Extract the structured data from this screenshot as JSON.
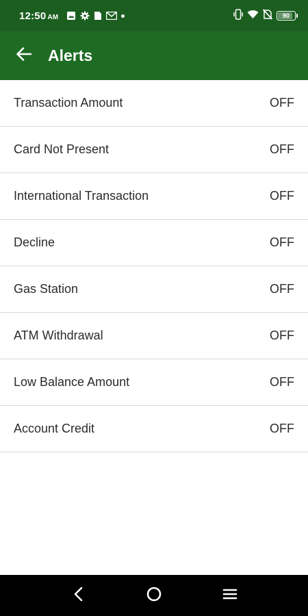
{
  "status_bar": {
    "time": "12:50",
    "ampm": "AM",
    "battery_level": "90",
    "icons": [
      "gallery-icon",
      "settings-icon",
      "sim-card-icon",
      "mail-icon",
      "dot-icon",
      "vibrate-icon",
      "wifi-icon",
      "no-sim-icon",
      "battery-icon"
    ]
  },
  "app_bar": {
    "title": "Alerts",
    "back_icon": "arrow-left-icon"
  },
  "alerts": [
    {
      "label": "Transaction Amount",
      "status": "OFF"
    },
    {
      "label": "Card Not Present",
      "status": "OFF"
    },
    {
      "label": "International Transaction",
      "status": "OFF"
    },
    {
      "label": "Decline",
      "status": "OFF"
    },
    {
      "label": "Gas Station",
      "status": "OFF"
    },
    {
      "label": "ATM Withdrawal",
      "status": "OFF"
    },
    {
      "label": "Low Balance Amount",
      "status": "OFF"
    },
    {
      "label": "Account Credit",
      "status": "OFF"
    }
  ],
  "nav_bar": {
    "icons": [
      "back-nav-icon",
      "home-nav-icon",
      "recents-nav-icon"
    ]
  },
  "colors": {
    "status_bar_bg": "#1b5e20",
    "app_bar_bg": "#1e6b24",
    "divider": "#d9d9d9",
    "text": "#2b2b2b"
  }
}
